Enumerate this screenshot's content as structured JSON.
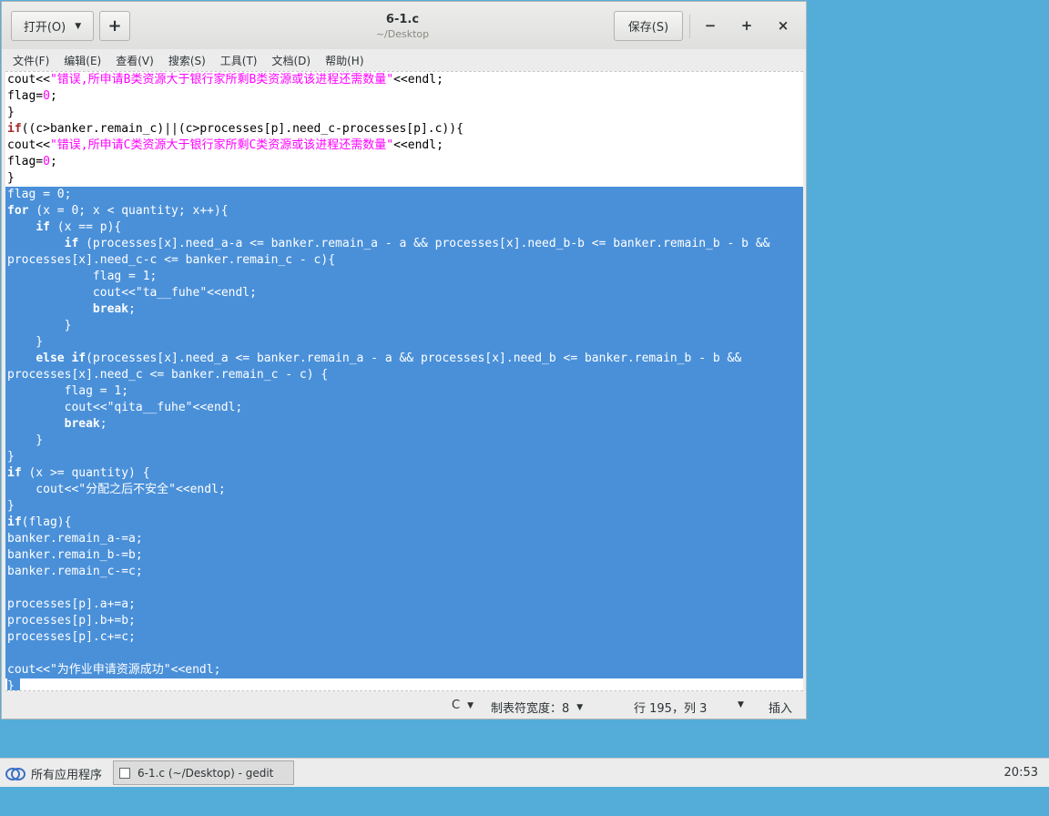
{
  "window": {
    "title": "6-1.c",
    "subtitle": "~/Desktop",
    "open_label": "打开(O)",
    "new_tab_symbol": "+",
    "save_label": "保存(S)",
    "minimize_symbol": "−",
    "maximize_symbol": "+",
    "close_symbol": "×"
  },
  "menu": {
    "items": [
      "文件(F)",
      "编辑(E)",
      "查看(V)",
      "搜索(S)",
      "工具(T)",
      "文档(D)",
      "帮助(H)"
    ]
  },
  "status": {
    "language": "C",
    "tab_width": "制表符宽度：8",
    "position": "行 195，列 3",
    "mode": "插入"
  },
  "taskbar": {
    "apps_label": "所有应用程序",
    "task_label": "6-1.c (~/Desktop) - gedit",
    "clock": "20:53"
  },
  "colors": {
    "desktop": "#54add9",
    "selection": "#4a90d9",
    "keyword": "#a52a2a",
    "string": "#ff00ff"
  }
}
